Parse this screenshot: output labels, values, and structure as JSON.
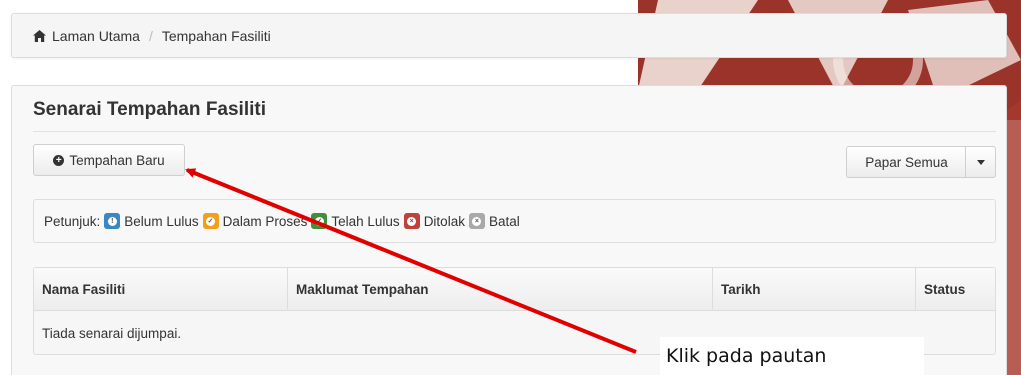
{
  "colors": {
    "info": "#3a87c1",
    "warning": "#f0a01e",
    "success": "#3f8f3f",
    "danger": "#c0403c",
    "muted": "#a9a9a9",
    "arrow": "#e00000"
  },
  "breadcrumb": {
    "icon": "home-icon",
    "home": "Laman Utama",
    "separator": "/",
    "current": "Tempahan Fasiliti"
  },
  "panel": {
    "title": "Senarai Tempahan Fasiliti",
    "new_button": "Tempahan Baru",
    "show_all": "Papar Semua"
  },
  "legend": {
    "label": "Petunjuk:",
    "items": [
      {
        "label": "Belum Lulus",
        "icon": "info-badge-icon"
      },
      {
        "label": "Dalam Proses",
        "icon": "check-badge-icon"
      },
      {
        "label": "Telah Lulus",
        "icon": "check-badge-icon"
      },
      {
        "label": "Ditolak",
        "icon": "x-badge-icon"
      },
      {
        "label": "Batal",
        "icon": "x-badge-icon"
      }
    ]
  },
  "table": {
    "headers": [
      "Nama Fasiliti",
      "Maklumat Tempahan",
      "Tarikh",
      "Status"
    ],
    "empty_text": "Tiada senarai dijumpai."
  },
  "annotation": {
    "text": "Klik pada pautan"
  }
}
